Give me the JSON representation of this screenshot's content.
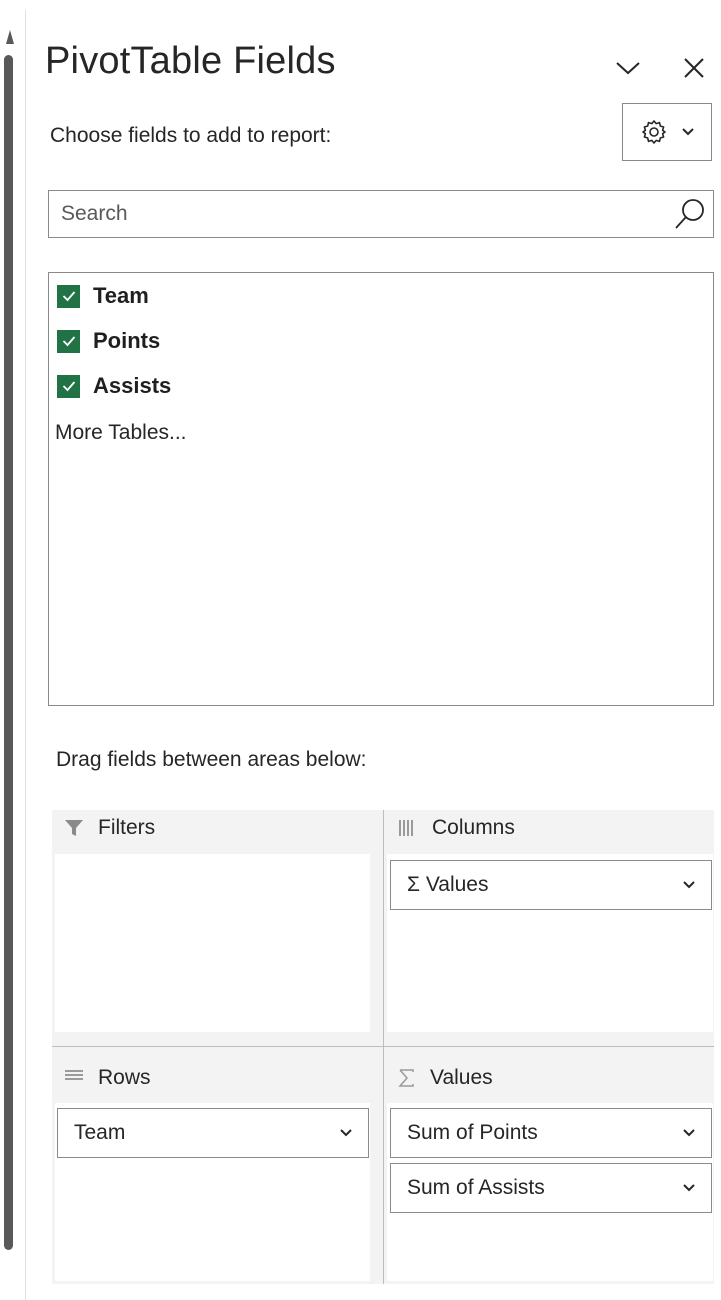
{
  "header": {
    "title": "PivotTable Fields",
    "collapse_icon": "chevron-down-icon",
    "close_icon": "close-icon"
  },
  "subtitle": "Choose fields to add to report:",
  "tools": {
    "icon": "gear-icon",
    "dropdown_icon": "chevron-down-icon"
  },
  "search": {
    "placeholder": "Search",
    "value": ""
  },
  "fields": [
    {
      "label": "Team",
      "checked": true
    },
    {
      "label": "Points",
      "checked": true
    },
    {
      "label": "Assists",
      "checked": true
    }
  ],
  "more_tables": "More Tables...",
  "drag_label": "Drag fields between areas below:",
  "areas": {
    "filters": {
      "label": "Filters",
      "icon": "filter-icon",
      "items": []
    },
    "columns": {
      "label": "Columns",
      "icon": "columns-icon",
      "items": [
        "Σ Values"
      ]
    },
    "rows": {
      "label": "Rows",
      "icon": "rows-icon",
      "items": [
        "Team"
      ]
    },
    "values": {
      "label": "Values",
      "icon": "sigma-icon",
      "items": [
        "Sum of Points",
        "Sum of Assists"
      ]
    }
  },
  "colors": {
    "checkbox": "#217346",
    "border": "#8a8a8a",
    "text": "#262626",
    "zone": "#f3f3f3"
  }
}
